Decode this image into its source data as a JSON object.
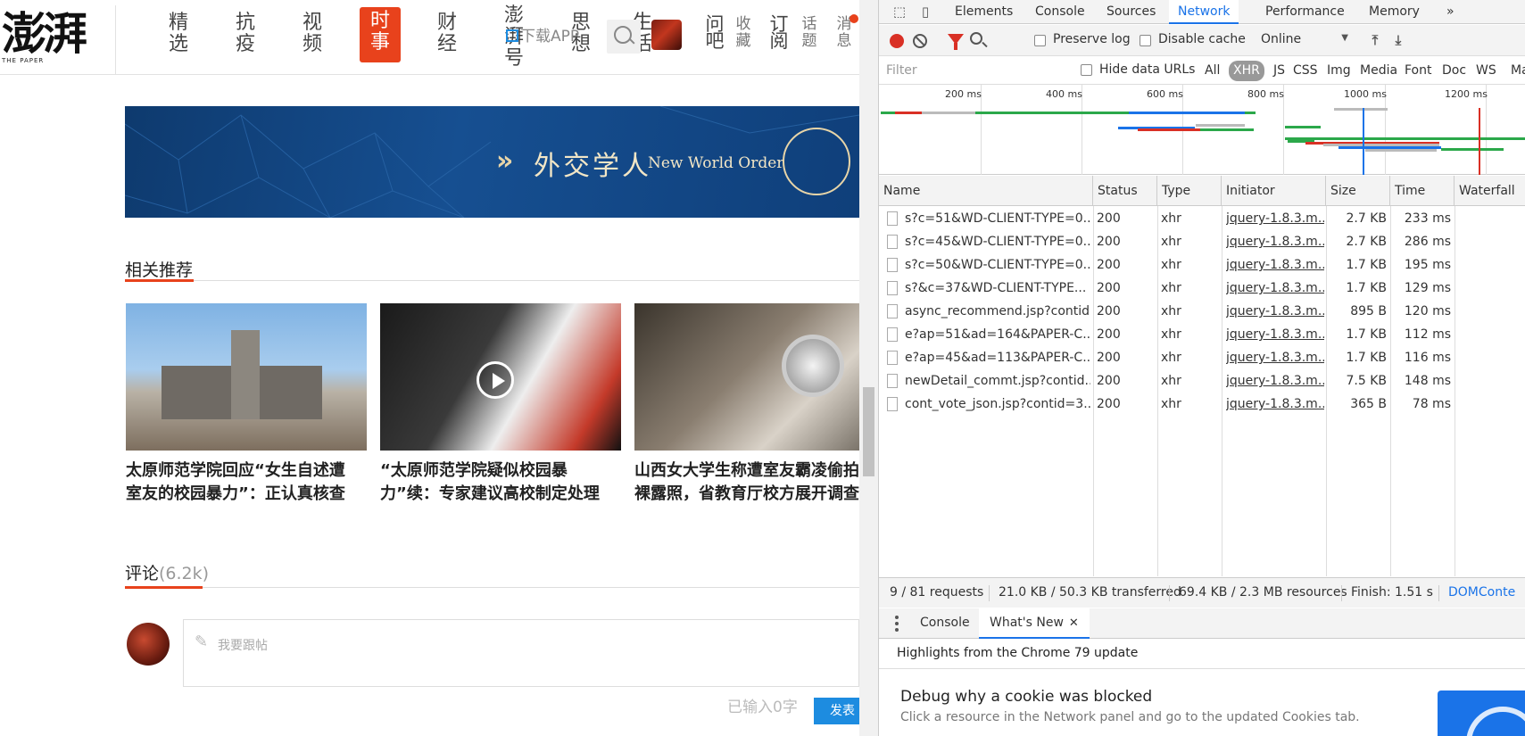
{
  "site": {
    "logo_text": "澎湃",
    "logo_sub": "THE PAPER",
    "nav": [
      {
        "label": "精选"
      },
      {
        "label": "抗疫"
      },
      {
        "label": "视频"
      },
      {
        "label": "时事"
      },
      {
        "label": "财经"
      },
      {
        "label": "澎湃号"
      },
      {
        "label": "思想"
      },
      {
        "label": "生活"
      }
    ],
    "nav_small": [
      {
        "label": "问吧"
      },
      {
        "label": "收藏"
      },
      {
        "label": "订阅"
      },
      {
        "label": "话题"
      },
      {
        "label": "消息"
      }
    ],
    "app_download": "下载APP",
    "banner": {
      "cn": "外交学人",
      "en": "New World Order",
      "chev": "»"
    },
    "related": {
      "title": "相关推荐",
      "cards": [
        {
          "title": "太原师范学院回应“女生自述遭室友的校园暴力”：正认真核查"
        },
        {
          "title": "“太原师范学院疑似校园暴力”续：专家建议高校制定处理规定"
        },
        {
          "title": "山西女大学生称遭室友霸凌偷拍裸露照，省教育厅校方展开调查"
        }
      ]
    },
    "comments": {
      "title": "评论",
      "count": "(6.2k)",
      "placeholder": "我要跟帖",
      "char_count": "已输入0字",
      "send": "发表"
    }
  },
  "devtools": {
    "tabs": [
      "Elements",
      "Console",
      "Sources",
      "Network",
      "Performance",
      "Memory"
    ],
    "active_tab": "Network",
    "more_tabs": "»",
    "toolbar": {
      "preserve_log": "Preserve log",
      "disable_cache": "Disable cache",
      "throttling": "Online"
    },
    "filter": {
      "placeholder": "Filter",
      "hide_data_urls": "Hide data URLs",
      "types": [
        "All",
        "XHR",
        "JS",
        "CSS",
        "Img",
        "Media",
        "Font",
        "Doc",
        "WS",
        "Ma"
      ],
      "active_type": "XHR"
    },
    "overview": {
      "ticks": [
        "200 ms",
        "400 ms",
        "600 ms",
        "800 ms",
        "1000 ms",
        "1200 ms"
      ]
    },
    "columns": [
      "Name",
      "Status",
      "Type",
      "Initiator",
      "Size",
      "Time",
      "Waterfall"
    ],
    "requests": [
      {
        "name": "s?c=51&WD-CLIENT-TYPE=0...",
        "status": "200",
        "type": "xhr",
        "initiator": "jquery-1.8.3.m...",
        "size": "2.7 KB",
        "time": "233 ms"
      },
      {
        "name": "s?c=45&WD-CLIENT-TYPE=0...",
        "status": "200",
        "type": "xhr",
        "initiator": "jquery-1.8.3.m...",
        "size": "2.7 KB",
        "time": "286 ms"
      },
      {
        "name": "s?c=50&WD-CLIENT-TYPE=0...",
        "status": "200",
        "type": "xhr",
        "initiator": "jquery-1.8.3.m...",
        "size": "1.7 KB",
        "time": "195 ms"
      },
      {
        "name": "s?&c=37&WD-CLIENT-TYPE...",
        "status": "200",
        "type": "xhr",
        "initiator": "jquery-1.8.3.m...",
        "size": "1.7 KB",
        "time": "129 ms"
      },
      {
        "name": "async_recommend.jsp?contid...",
        "status": "200",
        "type": "xhr",
        "initiator": "jquery-1.8.3.m...",
        "size": "895 B",
        "time": "120 ms"
      },
      {
        "name": "e?ap=51&ad=164&PAPER-C...",
        "status": "200",
        "type": "xhr",
        "initiator": "jquery-1.8.3.m...",
        "size": "1.7 KB",
        "time": "112 ms"
      },
      {
        "name": "e?ap=45&ad=113&PAPER-C...",
        "status": "200",
        "type": "xhr",
        "initiator": "jquery-1.8.3.m...",
        "size": "1.7 KB",
        "time": "116 ms"
      },
      {
        "name": "newDetail_commt.jsp?contid...",
        "status": "200",
        "type": "xhr",
        "initiator": "jquery-1.8.3.m...",
        "size": "7.5 KB",
        "time": "148 ms"
      },
      {
        "name": "cont_vote_json.jsp?contid=3...",
        "status": "200",
        "type": "xhr",
        "initiator": "jquery-1.8.3.m...",
        "size": "365 B",
        "time": "78 ms"
      }
    ],
    "status_bar": {
      "requests": "9 / 81 requests",
      "transferred": "21.0 KB / 50.3 KB transferred",
      "resources": "69.4 KB / 2.3 MB resources",
      "finish": "Finish: 1.51 s",
      "dom": "DOMConte"
    },
    "drawer": {
      "tabs": [
        "Console",
        "What's New"
      ],
      "active": "What's New",
      "close": "✕",
      "header": "Highlights from the Chrome 79 update",
      "item_title": "Debug why a cookie was blocked",
      "item_desc": "Click a resource in the Network panel and go to the updated Cookies tab."
    },
    "colors": {
      "accent": "#1a73e8",
      "record": "#d93025"
    }
  }
}
